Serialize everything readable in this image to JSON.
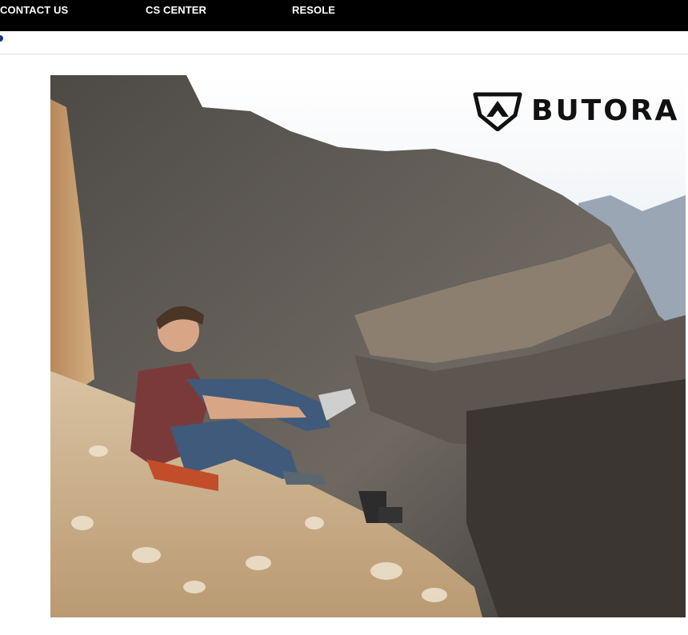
{
  "nav": {
    "items": [
      {
        "label": "CONTACT US"
      },
      {
        "label": "CS CENTER"
      },
      {
        "label": "RESOLE"
      }
    ]
  },
  "hero": {
    "brand_name": "BUTORA",
    "logo_icon": "butora-logo-icon",
    "image": "climber-sitting-on-rocky-cliff-photo"
  },
  "colors": {
    "topbar": "#000000",
    "nav_text": "#ffffff",
    "brand_text": "#111111"
  }
}
